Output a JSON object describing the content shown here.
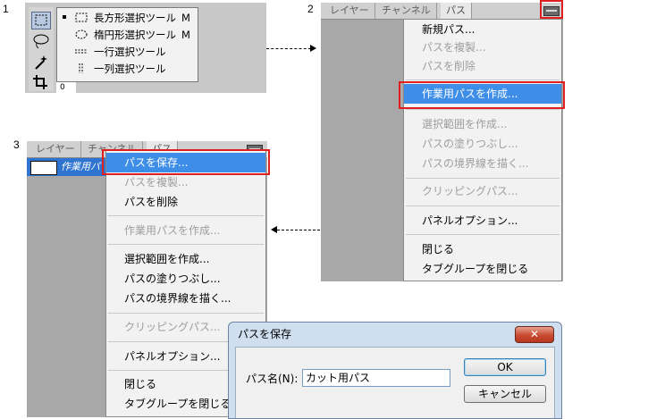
{
  "steps": {
    "one": "1",
    "two": "2",
    "three": "3"
  },
  "tool_menu": {
    "items": [
      {
        "label": "長方形選択ツール",
        "key": "M",
        "selected": true
      },
      {
        "label": "楕円形選択ツール",
        "key": "M",
        "selected": false
      },
      {
        "label": "一行選択ツール",
        "key": "",
        "selected": false
      },
      {
        "label": "一列選択ツール",
        "key": "",
        "selected": false
      }
    ],
    "ruler_label": "0"
  },
  "panel_tabs": {
    "layers": "レイヤー",
    "channels": "チャンネル",
    "paths": "パス"
  },
  "panel2_menu": {
    "new_path": "新規パス...",
    "duplicate_path": "パスを複製...",
    "delete_path": "パスを削除",
    "make_work_path": "作業用パスを作成...",
    "make_selection": "選択範囲を作成...",
    "fill_path": "パスの塗りつぶし...",
    "stroke_path": "パスの境界線を描く...",
    "clipping_path": "クリッピングパス...",
    "panel_options": "パネルオプション...",
    "close": "閉じる",
    "close_tab_group": "タブグループを閉じる"
  },
  "panel3": {
    "row_label": "作業用パ"
  },
  "panel3_menu": {
    "save_path": "パスを保存...",
    "duplicate_path": "パスを複製...",
    "delete_path": "パスを削除",
    "make_work_path": "作業用パスを作成...",
    "make_selection": "選択範囲を作成...",
    "fill_path": "パスの塗りつぶし...",
    "stroke_path": "パスの境界線を描く...",
    "clipping_path": "クリッピングパス...",
    "panel_options": "パネルオプション...",
    "close": "閉じる",
    "close_tab_group": "タブグループを閉じる"
  },
  "dialog": {
    "title": "パスを保存",
    "close_symbol": "✕",
    "name_label": "パス名(N):",
    "name_value": "カット用パス",
    "ok": "OK",
    "cancel": "キャンセル"
  },
  "colors": {
    "highlight": "#3e8ee8",
    "callout": "#e02020",
    "selected_row": "#2f74d0"
  }
}
